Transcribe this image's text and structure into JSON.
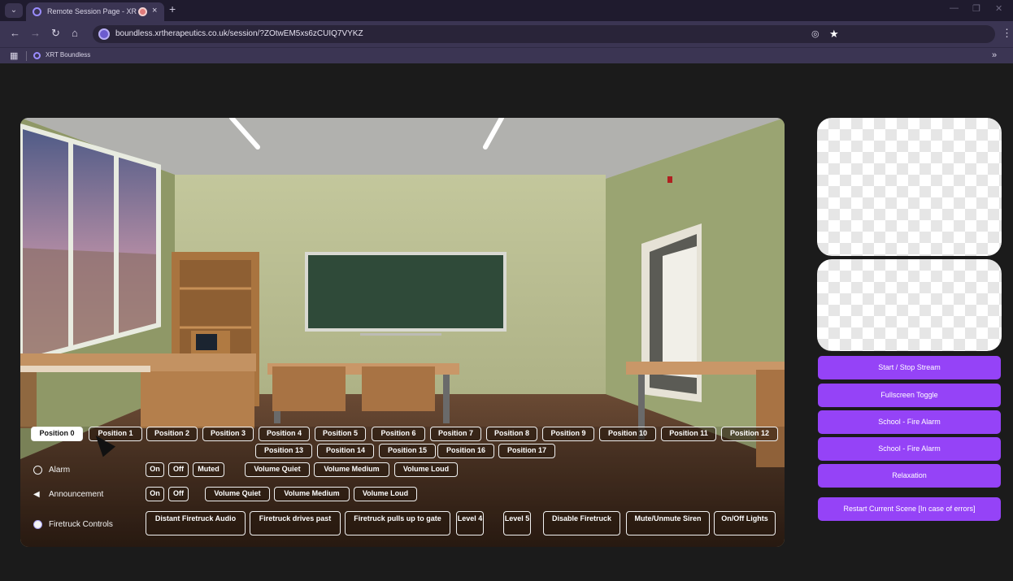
{
  "browser": {
    "tab_title": "Remote Session Page - XR",
    "url": "boundless.xrtherapeutics.co.uk/session/?ZOtwEM5xs6zCUIQ7VYKZ",
    "bookmark_label": "XRT Boundless",
    "new_tab_label": "+",
    "close_tab_label": "×",
    "minimize_label": "—",
    "restore_label": "❐",
    "close_window_label": "✕"
  },
  "positions": {
    "selected": "Position 0",
    "row1": [
      "Position 0",
      "Position 1",
      "Position 2",
      "Position 3",
      "Position 4",
      "Position 5",
      "Position 6",
      "Position 7",
      "Position 8",
      "Position 9",
      "Position 10",
      "Position 11",
      "Position 12"
    ],
    "row2": [
      "Position 13",
      "Position 14",
      "Position 15",
      "Position 16",
      "Position 17"
    ]
  },
  "controls": {
    "alarm": {
      "label": "Alarm",
      "buttons": [
        "On",
        "Off",
        "Muted",
        "Volume Quiet",
        "Volume Medium",
        "Volume Loud"
      ]
    },
    "announcement": {
      "label": "Announcement",
      "buttons": [
        "On",
        "Off",
        "Volume Quiet",
        "Volume Medium",
        "Volume Loud"
      ]
    },
    "firetruck": {
      "label": "Firetruck Controls",
      "buttons": [
        "Distant Firetruck Audio",
        "Firetruck drives past",
        "Firetruck pulls up to gate",
        "Level 4",
        "Level 5",
        "Disable Firetruck",
        "Mute/Unmute Siren",
        "On/Off Lights"
      ]
    }
  },
  "panel": {
    "buttons": [
      "Start / Stop Stream",
      "Fullscreen Toggle",
      "School - Fire Alarm",
      "School - Fire Alarm",
      "Relaxation"
    ],
    "restart": "Restart Current Scene [In case of errors]"
  },
  "colors": {
    "accent": "#9543f7",
    "background": "#1b1b1b",
    "chrome": "#3b3553"
  }
}
